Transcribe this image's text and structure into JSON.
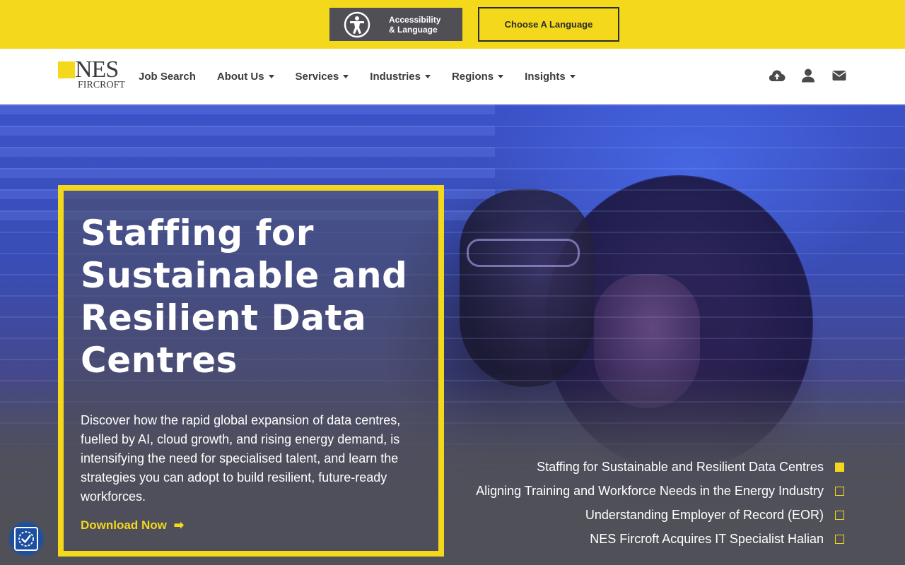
{
  "topbar": {
    "accessibility_label_line1": "Accessibility",
    "accessibility_label_line2": "& Language",
    "language_button": "Choose A Language",
    "accent_color": "#f4d81c"
  },
  "brand": {
    "logo_nes": "NES",
    "logo_fircroft": "FIRCROFT"
  },
  "nav": {
    "items": [
      {
        "label": "Job Search",
        "has_dropdown": false
      },
      {
        "label": "About Us",
        "has_dropdown": true
      },
      {
        "label": "Services",
        "has_dropdown": true
      },
      {
        "label": "Industries",
        "has_dropdown": true
      },
      {
        "label": "Regions",
        "has_dropdown": true
      },
      {
        "label": "Insights",
        "has_dropdown": true
      }
    ],
    "icons": [
      "cloud-upload-icon",
      "user-icon",
      "envelope-icon"
    ]
  },
  "hero": {
    "title": "Staffing for Sustainable and Resilient Data Centres",
    "description": "Discover how the rapid global expansion of data centres, fuelled by AI, cloud growth, and rising energy demand, is intensifying the need for specialised talent, and learn the strategies you can adopt to build resilient, future-ready workforces.",
    "cta_label": "Download Now",
    "cta_arrow": "➡"
  },
  "slides": [
    {
      "label": "Staffing for Sustainable and Resilient Data Centres",
      "active": true
    },
    {
      "label": "Aligning Training and Workforce Needs in the Energy Industry",
      "active": false
    },
    {
      "label": "Understanding Employer of Record (EOR)",
      "active": false
    },
    {
      "label": "NES Fircroft Acquires IT Specialist Halian",
      "active": false
    }
  ]
}
